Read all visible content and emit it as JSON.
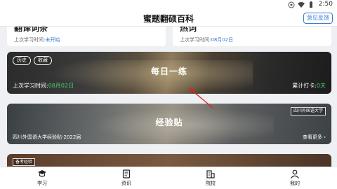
{
  "status_bar": {
    "time": "2:50",
    "icons": [
      "notification-icon",
      "wifi-icon",
      "battery-icon"
    ]
  },
  "header": {
    "title": "蜜题翻硕百科",
    "feedback_label": "意见反馈"
  },
  "top_cards": [
    {
      "title": "翻译词条",
      "last_study_label": "上次学习时间:",
      "last_study_value": "未开始"
    },
    {
      "title": "热词",
      "last_study_label": "上次学习时间:",
      "last_study_value": "08月02日"
    }
  ],
  "daily_practice": {
    "tags": [
      "历史",
      "收藏"
    ],
    "title": "每日一练",
    "last_study_label": "上次学习时间:",
    "last_study_value": "08月02日",
    "streak_label": "累计打卡:",
    "streak_value": "0天"
  },
  "experience": {
    "title": "经验贴",
    "badge": "四川外国语大学",
    "subtitle": "四川外国语大学经验贴-2022届",
    "more_label": "查看更多 ›"
  },
  "next_card": {
    "badge": "备考经验"
  },
  "bottom_nav": [
    {
      "label": "学习",
      "icon": "graduation-cap-icon"
    },
    {
      "label": "资讯",
      "icon": "news-icon"
    },
    {
      "label": "院校",
      "icon": "school-icon"
    },
    {
      "label": "我的",
      "icon": "user-icon"
    }
  ],
  "colors": {
    "accent": "#3a7bd5",
    "green": "#46d06a",
    "arrow": "#e02020"
  }
}
